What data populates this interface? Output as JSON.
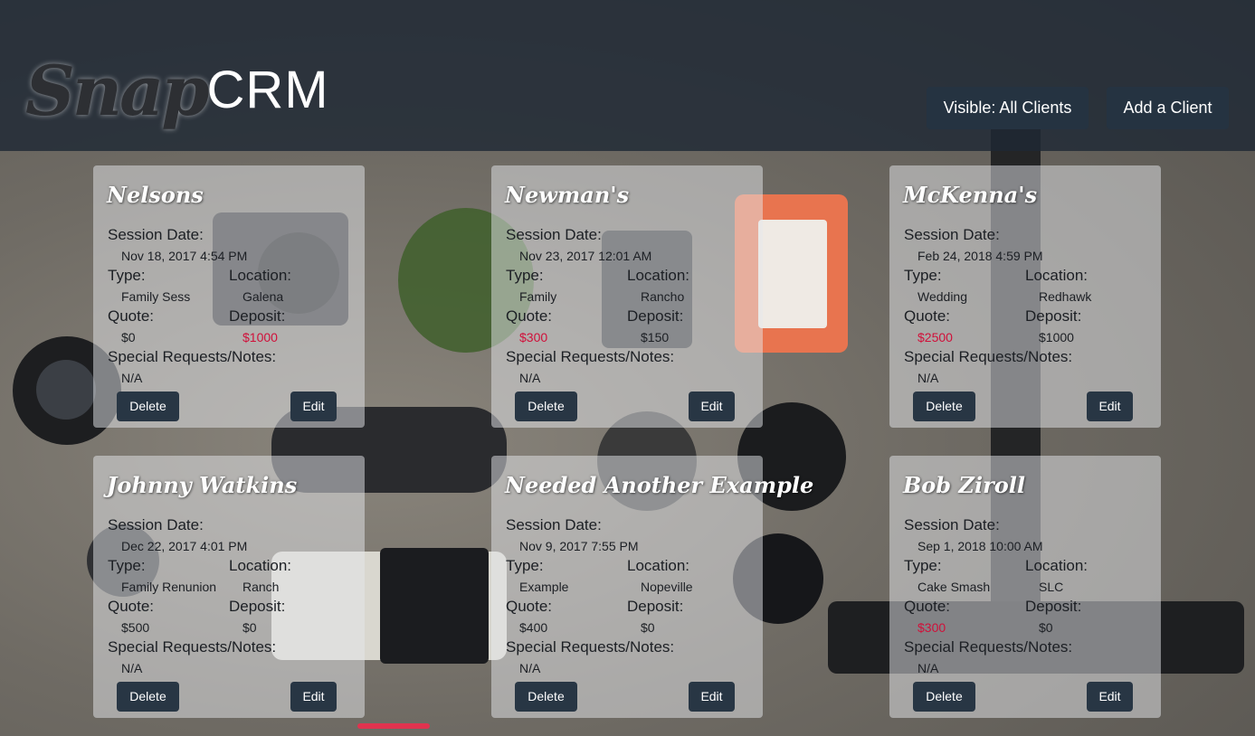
{
  "app": {
    "logo_script": "Snap",
    "logo_text": "CRM"
  },
  "header": {
    "visible_label": "Visible: All Clients",
    "add_label": "Add a Client"
  },
  "labels": {
    "session_date": "Session Date:",
    "type": "Type:",
    "location": "Location:",
    "quote": "Quote:",
    "deposit": "Deposit:",
    "notes": "Special Requests/Notes:",
    "delete": "Delete",
    "edit": "Edit"
  },
  "clients": [
    {
      "name": "Nelsons",
      "date": "Nov 18, 2017 4:54 PM",
      "type": "Family Sess",
      "location": "Galena",
      "quote": "$0",
      "deposit": "$1000",
      "notes": "N/A",
      "quote_alert": false,
      "deposit_alert": true
    },
    {
      "name": "Newman's",
      "date": "Nov 23, 2017 12:01 AM",
      "type": "Family",
      "location": "Rancho",
      "quote": "$300",
      "deposit": "$150",
      "notes": "N/A",
      "quote_alert": true,
      "deposit_alert": false
    },
    {
      "name": "McKenna's",
      "date": "Feb 24, 2018 4:59 PM",
      "type": "Wedding",
      "location": "Redhawk",
      "quote": "$2500",
      "deposit": "$1000",
      "notes": "N/A",
      "quote_alert": true,
      "deposit_alert": false
    },
    {
      "name": "Johnny Watkins",
      "date": "Dec 22, 2017 4:01 PM",
      "type": "Family Renunion",
      "location": "Ranch",
      "quote": "$500",
      "deposit": "$0",
      "notes": "N/A",
      "quote_alert": false,
      "deposit_alert": false
    },
    {
      "name": "Needed Another Example",
      "date": "Nov 9, 2017 7:55 PM",
      "type": "Example",
      "location": "Nopeville",
      "quote": "$400",
      "deposit": "$0",
      "notes": "N/A",
      "quote_alert": false,
      "deposit_alert": false
    },
    {
      "name": "Bob Ziroll",
      "date": "Sep 1, 2018 10:00 AM",
      "type": "Cake Smash",
      "location": "SLC",
      "quote": "$300",
      "deposit": "$0",
      "notes": "N/A",
      "quote_alert": true,
      "deposit_alert": false
    }
  ],
  "colors": {
    "header_bg": "#1e2834",
    "button_bg": "#253341",
    "alert_red": "#d0103a"
  }
}
